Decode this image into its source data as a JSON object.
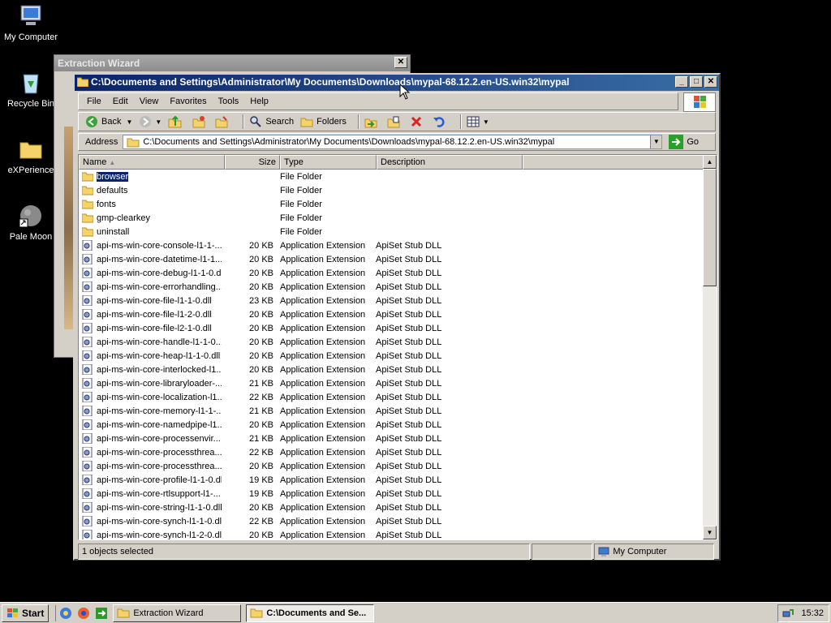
{
  "desktop": {
    "icons": [
      {
        "label": "My Computer"
      },
      {
        "label": "Recycle Bin"
      },
      {
        "label": "eXPerience"
      },
      {
        "label": "Pale Moon"
      }
    ]
  },
  "wizard": {
    "title": "Extraction Wizard",
    "close_label": "✕"
  },
  "explorer": {
    "title": "C:\\Documents and Settings\\Administrator\\My Documents\\Downloads\\mypal-68.12.2.en-US.win32\\mypal",
    "menu": [
      "File",
      "Edit",
      "View",
      "Favorites",
      "Tools",
      "Help"
    ],
    "toolbar": {
      "back": "Back",
      "search": "Search",
      "folders": "Folders"
    },
    "address": {
      "label": "Address",
      "value": "C:\\Documents and Settings\\Administrator\\My Documents\\Downloads\\mypal-68.12.2.en-US.win32\\mypal",
      "go": "Go"
    },
    "columns": {
      "name": "Name",
      "size": "Size",
      "type": "Type",
      "description": "Description"
    },
    "files": [
      {
        "name": "browser",
        "size": "",
        "type": "File Folder",
        "description": "",
        "kind": "folder"
      },
      {
        "name": "defaults",
        "size": "",
        "type": "File Folder",
        "description": "",
        "kind": "folder"
      },
      {
        "name": "fonts",
        "size": "",
        "type": "File Folder",
        "description": "",
        "kind": "folder"
      },
      {
        "name": "gmp-clearkey",
        "size": "",
        "type": "File Folder",
        "description": "",
        "kind": "folder"
      },
      {
        "name": "uninstall",
        "size": "",
        "type": "File Folder",
        "description": "",
        "kind": "folder"
      },
      {
        "name": "api-ms-win-core-console-l1-1-...",
        "size": "20 KB",
        "type": "Application Extension",
        "description": "ApiSet Stub DLL",
        "kind": "dll"
      },
      {
        "name": "api-ms-win-core-datetime-l1-1...",
        "size": "20 KB",
        "type": "Application Extension",
        "description": "ApiSet Stub DLL",
        "kind": "dll"
      },
      {
        "name": "api-ms-win-core-debug-l1-1-0.dll",
        "size": "20 KB",
        "type": "Application Extension",
        "description": "ApiSet Stub DLL",
        "kind": "dll"
      },
      {
        "name": "api-ms-win-core-errorhandling...",
        "size": "20 KB",
        "type": "Application Extension",
        "description": "ApiSet Stub DLL",
        "kind": "dll"
      },
      {
        "name": "api-ms-win-core-file-l1-1-0.dll",
        "size": "23 KB",
        "type": "Application Extension",
        "description": "ApiSet Stub DLL",
        "kind": "dll"
      },
      {
        "name": "api-ms-win-core-file-l1-2-0.dll",
        "size": "20 KB",
        "type": "Application Extension",
        "description": "ApiSet Stub DLL",
        "kind": "dll"
      },
      {
        "name": "api-ms-win-core-file-l2-1-0.dll",
        "size": "20 KB",
        "type": "Application Extension",
        "description": "ApiSet Stub DLL",
        "kind": "dll"
      },
      {
        "name": "api-ms-win-core-handle-l1-1-0...",
        "size": "20 KB",
        "type": "Application Extension",
        "description": "ApiSet Stub DLL",
        "kind": "dll"
      },
      {
        "name": "api-ms-win-core-heap-l1-1-0.dll",
        "size": "20 KB",
        "type": "Application Extension",
        "description": "ApiSet Stub DLL",
        "kind": "dll"
      },
      {
        "name": "api-ms-win-core-interlocked-l1...",
        "size": "20 KB",
        "type": "Application Extension",
        "description": "ApiSet Stub DLL",
        "kind": "dll"
      },
      {
        "name": "api-ms-win-core-libraryloader-...",
        "size": "21 KB",
        "type": "Application Extension",
        "description": "ApiSet Stub DLL",
        "kind": "dll"
      },
      {
        "name": "api-ms-win-core-localization-l1...",
        "size": "22 KB",
        "type": "Application Extension",
        "description": "ApiSet Stub DLL",
        "kind": "dll"
      },
      {
        "name": "api-ms-win-core-memory-l1-1-...",
        "size": "21 KB",
        "type": "Application Extension",
        "description": "ApiSet Stub DLL",
        "kind": "dll"
      },
      {
        "name": "api-ms-win-core-namedpipe-l1...",
        "size": "20 KB",
        "type": "Application Extension",
        "description": "ApiSet Stub DLL",
        "kind": "dll"
      },
      {
        "name": "api-ms-win-core-processenvir...",
        "size": "21 KB",
        "type": "Application Extension",
        "description": "ApiSet Stub DLL",
        "kind": "dll"
      },
      {
        "name": "api-ms-win-core-processthrea...",
        "size": "22 KB",
        "type": "Application Extension",
        "description": "ApiSet Stub DLL",
        "kind": "dll"
      },
      {
        "name": "api-ms-win-core-processthrea...",
        "size": "20 KB",
        "type": "Application Extension",
        "description": "ApiSet Stub DLL",
        "kind": "dll"
      },
      {
        "name": "api-ms-win-core-profile-l1-1-0.dll",
        "size": "19 KB",
        "type": "Application Extension",
        "description": "ApiSet Stub DLL",
        "kind": "dll"
      },
      {
        "name": "api-ms-win-core-rtlsupport-l1-...",
        "size": "19 KB",
        "type": "Application Extension",
        "description": "ApiSet Stub DLL",
        "kind": "dll"
      },
      {
        "name": "api-ms-win-core-string-l1-1-0.dll",
        "size": "20 KB",
        "type": "Application Extension",
        "description": "ApiSet Stub DLL",
        "kind": "dll"
      },
      {
        "name": "api-ms-win-core-synch-l1-1-0.dll",
        "size": "22 KB",
        "type": "Application Extension",
        "description": "ApiSet Stub DLL",
        "kind": "dll"
      },
      {
        "name": "api-ms-win-core-synch-l1-2-0.dll",
        "size": "20 KB",
        "type": "Application Extension",
        "description": "ApiSet Stub DLL",
        "kind": "dll"
      }
    ],
    "status": {
      "selected": "1 objects selected",
      "zone": "My Computer"
    }
  },
  "taskbar": {
    "start": "Start",
    "tasks": [
      "Extraction Wizard",
      "C:\\Documents and Se..."
    ],
    "clock": "15:32"
  },
  "colors": {
    "title_active_start": "#0a246a",
    "title_active_end": "#3a6ea5",
    "selection": "#0a246a",
    "folder": "#f5d36a"
  }
}
